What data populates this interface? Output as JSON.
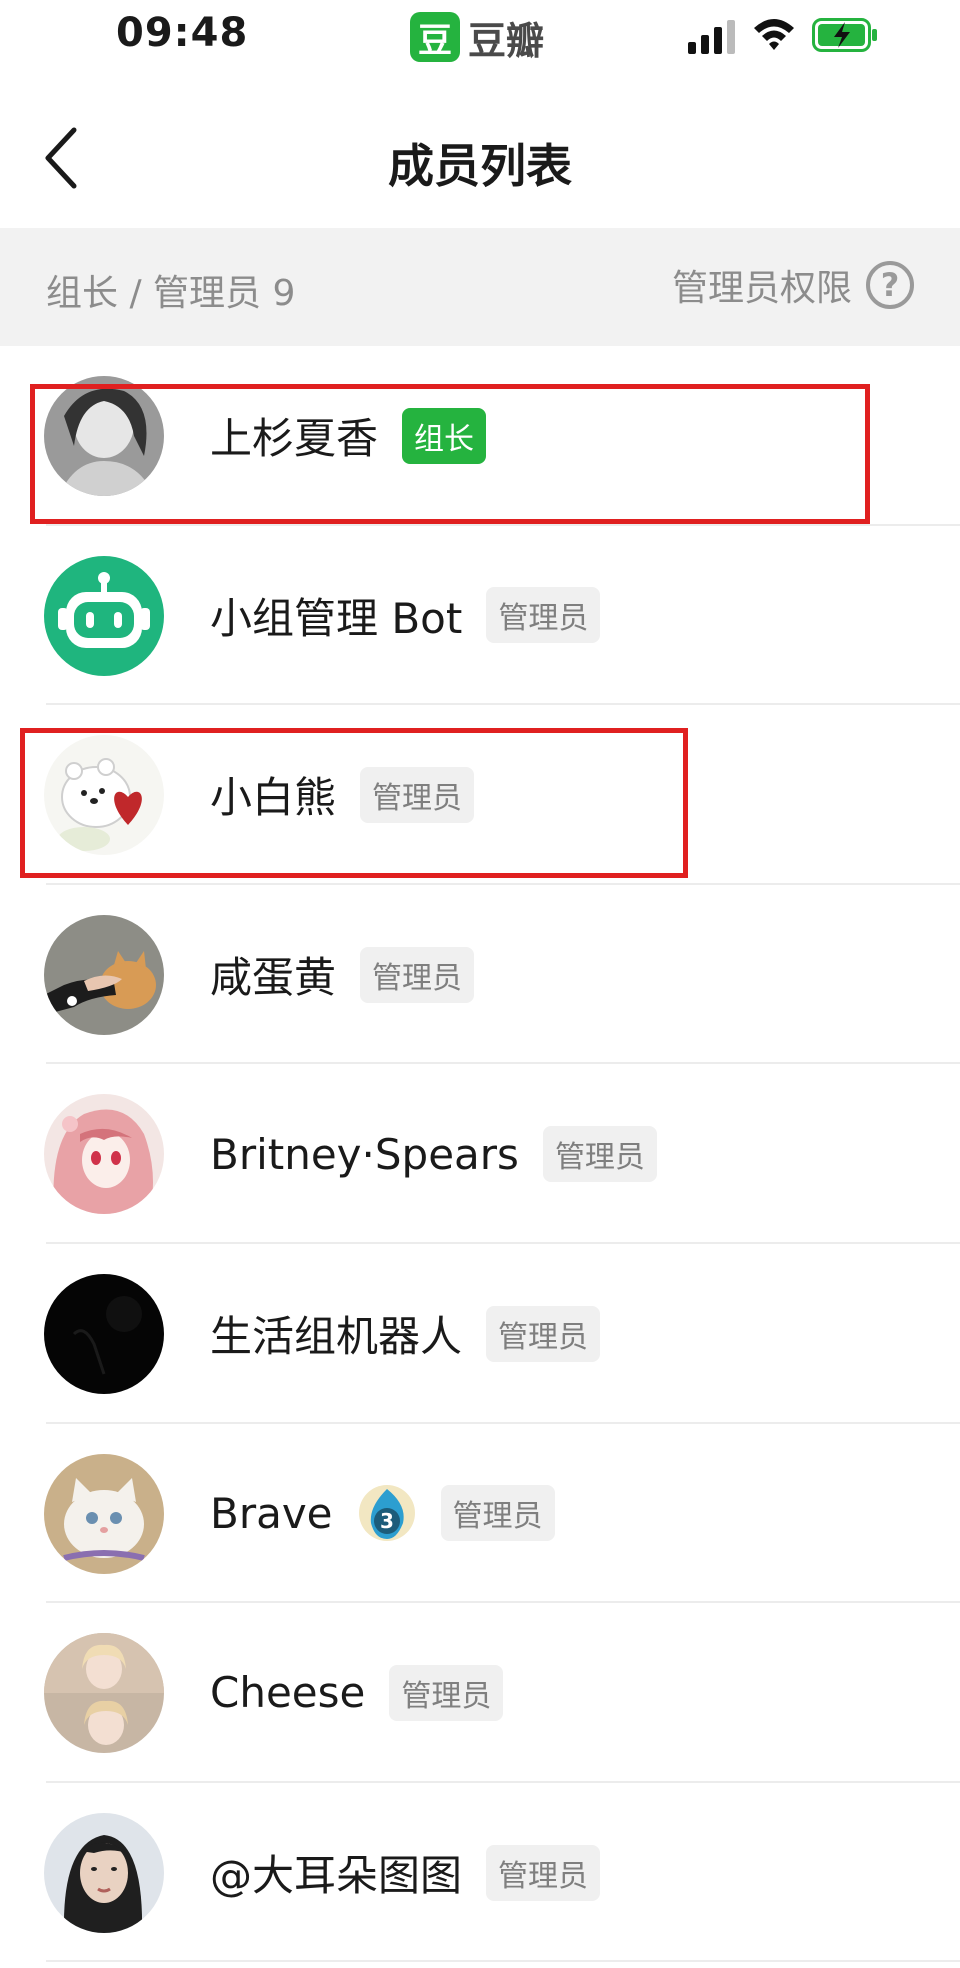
{
  "status_bar": {
    "time": "09:48",
    "app_logo_char": "豆",
    "app_name": "豆瓣",
    "icons": [
      "signal-icon",
      "wifi-icon",
      "battery-charging-icon"
    ]
  },
  "nav": {
    "title": "成员列表",
    "back_icon": "chevron-left-icon"
  },
  "section": {
    "title": "组长 / 管理员 9",
    "permissions_label": "管理员权限",
    "help_glyph": "?"
  },
  "members": [
    {
      "name": "上杉夏香",
      "role": "组长",
      "role_type": "owner",
      "avatar": "portrait-bw"
    },
    {
      "name": "小组管理 Bot",
      "role": "管理员",
      "role_type": "admin",
      "avatar": "robot"
    },
    {
      "name": "小白熊",
      "role": "管理员",
      "role_type": "admin",
      "avatar": "bear-heart"
    },
    {
      "name": "咸蛋黄",
      "role": "管理员",
      "role_type": "admin",
      "avatar": "cat-hand"
    },
    {
      "name": "Britney·Spears",
      "role": "管理员",
      "role_type": "admin",
      "avatar": "anime-pink"
    },
    {
      "name": "生活组机器人",
      "role": "管理员",
      "role_type": "admin",
      "avatar": "dark"
    },
    {
      "name": "Brave",
      "role": "管理员",
      "role_type": "admin",
      "avatar": "white-cat",
      "level_badge": "3"
    },
    {
      "name": "Cheese",
      "role": "管理员",
      "role_type": "admin",
      "avatar": "girl-collage"
    },
    {
      "name": "@大耳朵图图",
      "role": "管理员",
      "role_type": "admin",
      "avatar": "woman-portrait"
    }
  ],
  "colors": {
    "brand_green": "#25b33f",
    "highlight_red": "#e02020",
    "muted_text": "#8c8c8c",
    "section_bg": "#f2f2f2"
  }
}
